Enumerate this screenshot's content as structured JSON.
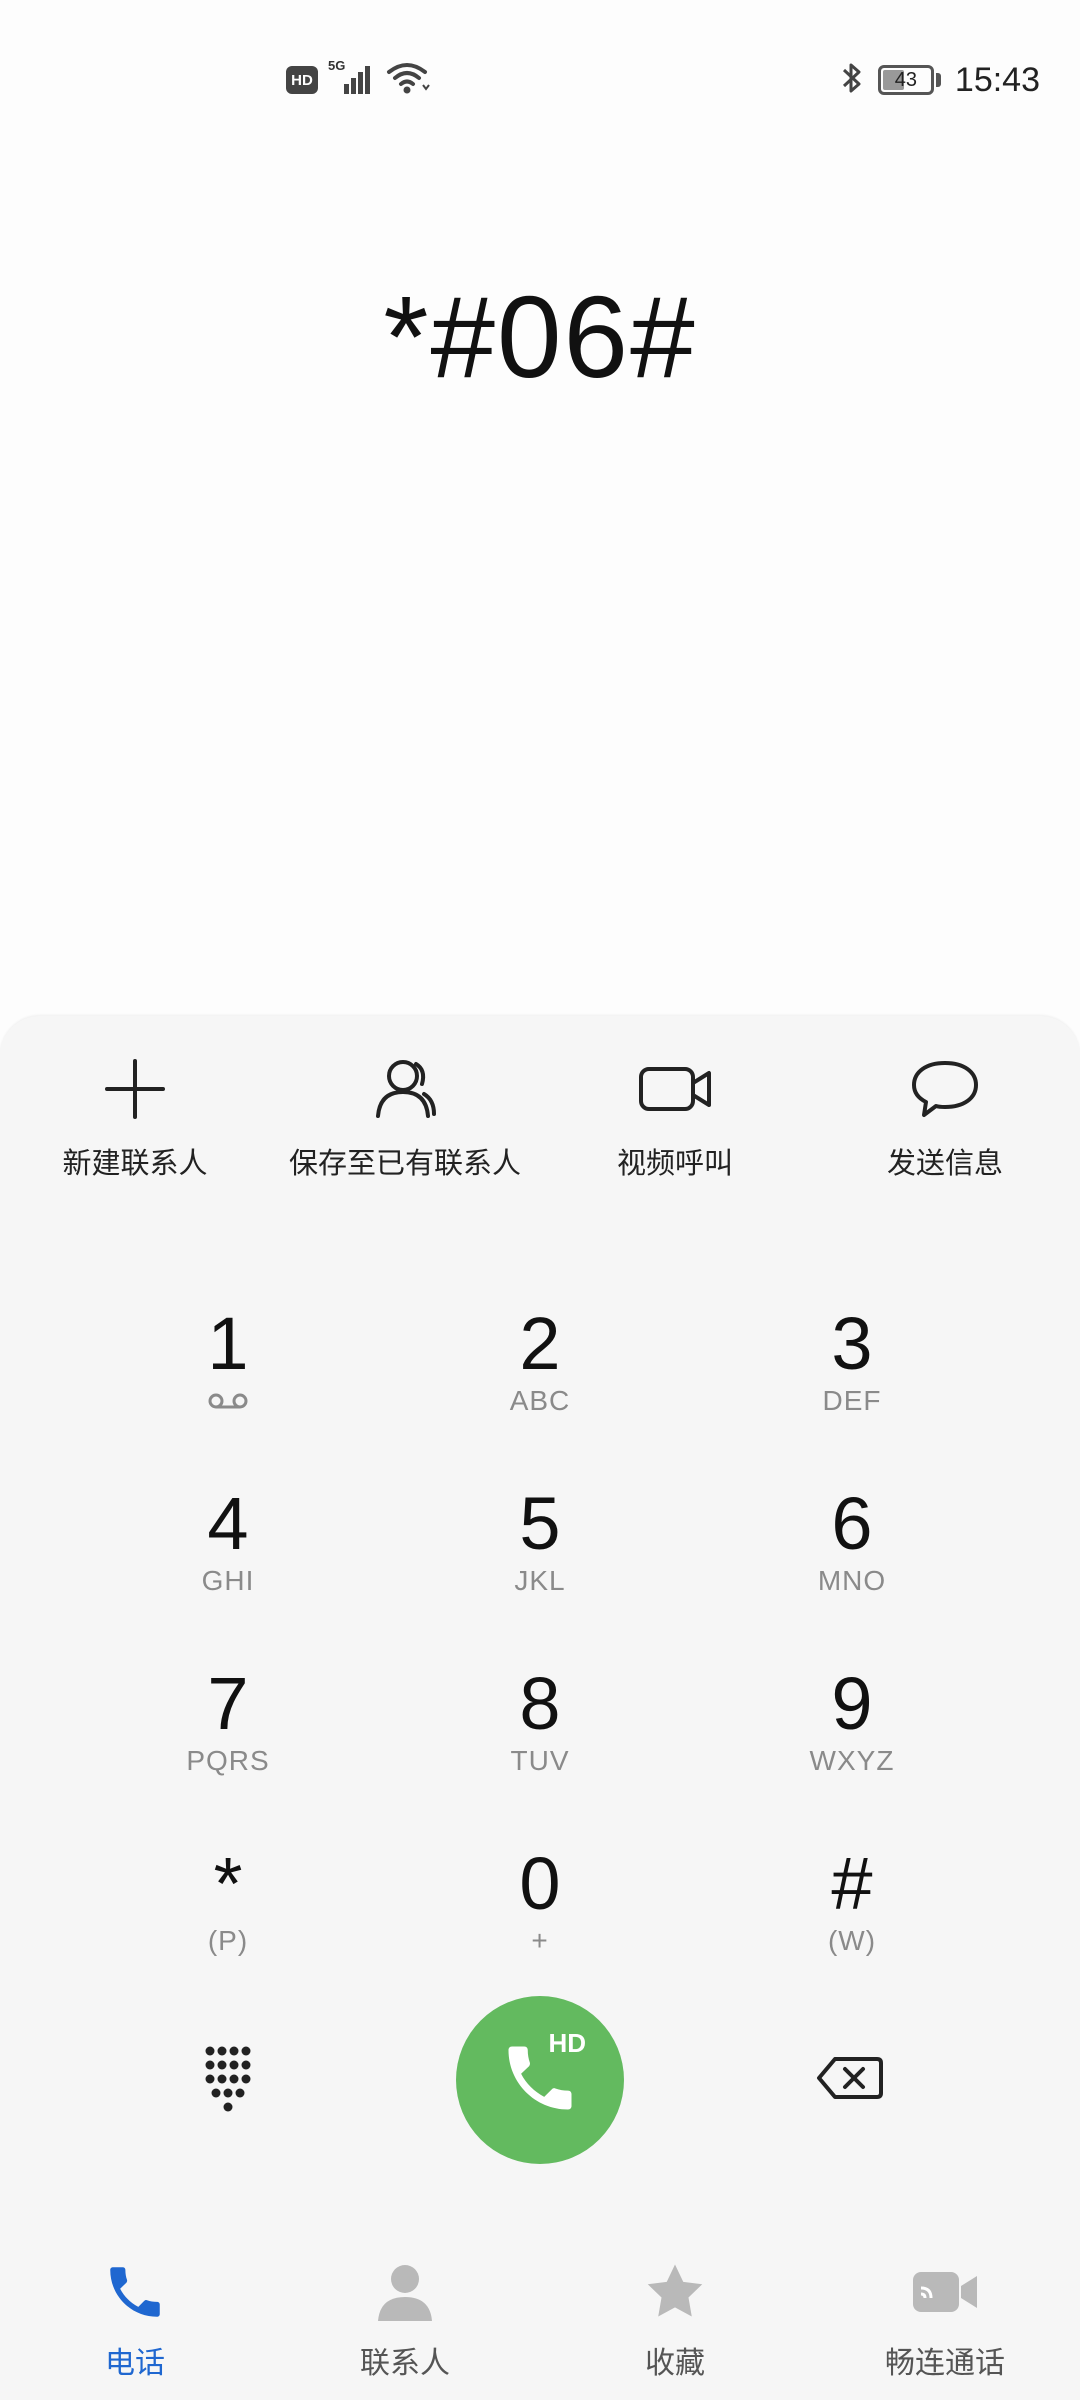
{
  "status_bar": {
    "hd_badge": "HD",
    "network": "5G",
    "battery": "43",
    "time": "15:43"
  },
  "dialer": {
    "number": "*#06#"
  },
  "actions": [
    {
      "label": "新建联系人",
      "icon": "add-contact-icon"
    },
    {
      "label": "保存至已有联系人",
      "icon": "person-icon"
    },
    {
      "label": "视频呼叫",
      "icon": "video-call-icon"
    },
    {
      "label": "发送信息",
      "icon": "message-icon"
    }
  ],
  "keypad": [
    {
      "digit": "1",
      "sub": ""
    },
    {
      "digit": "2",
      "sub": "ABC"
    },
    {
      "digit": "3",
      "sub": "DEF"
    },
    {
      "digit": "4",
      "sub": "GHI"
    },
    {
      "digit": "5",
      "sub": "JKL"
    },
    {
      "digit": "6",
      "sub": "MNO"
    },
    {
      "digit": "7",
      "sub": "PQRS"
    },
    {
      "digit": "8",
      "sub": "TUV"
    },
    {
      "digit": "9",
      "sub": "WXYZ"
    },
    {
      "digit": "*",
      "sub": "(P)"
    },
    {
      "digit": "0",
      "sub": "+"
    },
    {
      "digit": "#",
      "sub": "(W)"
    }
  ],
  "call_button": {
    "hd": "HD"
  },
  "nav": [
    {
      "label": "电话",
      "active": true
    },
    {
      "label": "联系人",
      "active": false
    },
    {
      "label": "收藏",
      "active": false
    },
    {
      "label": "畅连通话",
      "active": false
    }
  ],
  "colors": {
    "accent": "#1f67d0",
    "call_green": "#63ba5f",
    "panel_bg": "#f6f6f6",
    "inactive_icon": "#b9b9b9"
  }
}
